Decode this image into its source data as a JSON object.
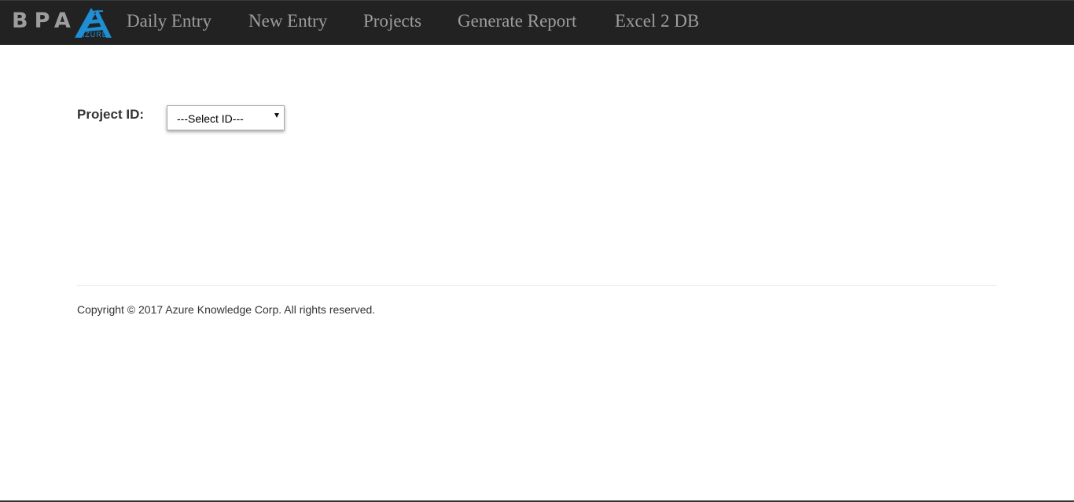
{
  "navbar": {
    "brand": "BPA",
    "logo_word": "AZURE",
    "logo_icon": "azure-triangle-logo",
    "items": [
      {
        "label": "Daily Entry"
      },
      {
        "label": "New Entry"
      },
      {
        "label": "Projects"
      },
      {
        "label": "Generate Report"
      },
      {
        "label": "Excel 2 DB"
      }
    ]
  },
  "form": {
    "project_id_label": "Project ID:",
    "project_id_select": {
      "selected": "---Select ID---"
    }
  },
  "footer": {
    "copyright": "Copyright © 2017 Azure Knowledge Corp. All rights reserved."
  },
  "colors": {
    "navbar_bg": "#222222",
    "nav_text": "#9d9d9d",
    "logo_blue": "#1e8fd5",
    "body_text": "#333333"
  }
}
